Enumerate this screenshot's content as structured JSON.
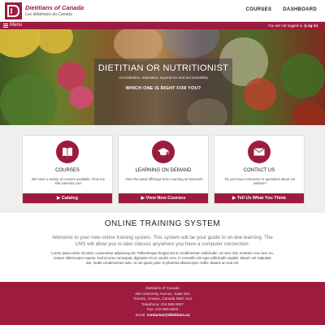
{
  "brand": {
    "name_en": "Dietitians of Canada",
    "name_fr": "Les diététistes du Canada",
    "accent": "#9c1b3f"
  },
  "nav": {
    "courses": "COURSES",
    "dashboard": "DASHBOARD"
  },
  "menubar": {
    "menu_label": "Menu",
    "status_prefix": "You are not logged in.",
    "login": "(Log in)"
  },
  "hero": {
    "title": "DIETITIAN OR NUTRITIONIST",
    "subtitle": "Accreditation, education, experience and accountability",
    "question": "WHICH ONE IS RIGHT FOR YOU?"
  },
  "cards": [
    {
      "icon": "book-icon",
      "title": "COURSES",
      "desc": "We have a variety of courses available. Find one that interests you!",
      "button": "Catalog"
    },
    {
      "icon": "graduation-cap-icon",
      "title": "LEARNING ON DEMAND",
      "desc": "View the latest offerings from Learning on Demand!",
      "button": "View New Courses"
    },
    {
      "icon": "envelope-icon",
      "title": "CONTACT US",
      "desc": "Do you have comments or questions about our website?",
      "button": "Tell Us What You Think"
    }
  ],
  "ots": {
    "title": "ONLINE TRAINING SYSTEM",
    "lead": "Welcome to your new online training system. This system will be your guide to on-line learning. The LMS will allow you to take classes anywhere you have a computer connection.",
    "body": "Lorem ipsum dolor sit amet, consectetur adipiscing elit. Pellentesque feugiat dui et condimentum sollicitudin. Ut nunc nisl, molestie non nunc eu, tempor ullamcorper massa. Sed id urna consequat, dignissim mi in, iaculis eros. In convallis nisi eget sollicitudin sagittis. Mauris vel vulputate nisi, mollis condimentum odio. Ut vel quam justo. In pharetra ullamcorper mollis. Mauris ac erat est."
  },
  "footer": {
    "org": "Dietitians of Canada",
    "address1": "480 University Avenue, Suite 604",
    "address2": "Toronto, Ontario, Canada M5G 1V2",
    "telephone": "Telephone: 416.596.0857",
    "fax": "Fax: 416.596.0603",
    "email_label": "Email:",
    "email": "contactus@dietitians.ca"
  }
}
